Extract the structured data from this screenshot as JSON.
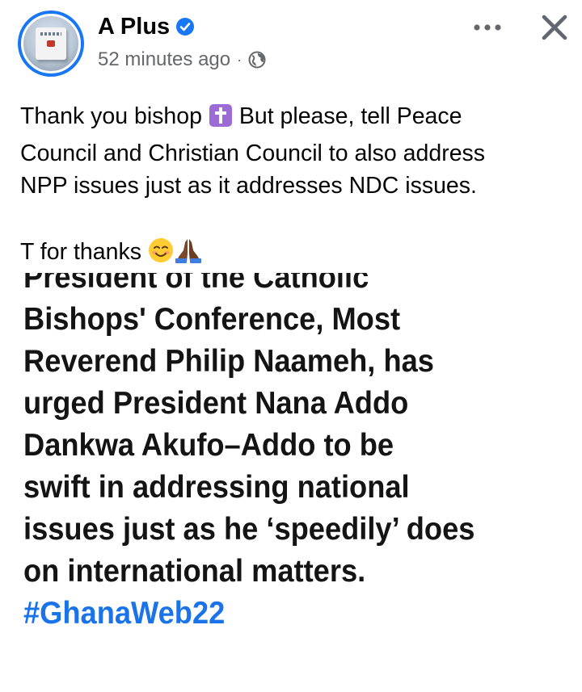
{
  "post": {
    "author": "A Plus",
    "time": "52 minutes ago",
    "separator": "·",
    "verified_icon": "verified-badge-icon",
    "privacy_icon": "globe-icon",
    "more_icon": "more-horizontal-icon",
    "close_icon": "close-icon",
    "caption": {
      "line1_before_emoji": "Thank you bishop",
      "line1_after_emoji": "But please, tell Peace",
      "line2": "Council and Christian Council to also address",
      "line3": "NPP issues just as it addresses NDC issues.",
      "line4_text": "T for thanks",
      "emoji_cross": "latin-cross-emoji",
      "emoji_smile": "smiling-face-emoji",
      "emoji_pray": "folded-hands-emoji"
    }
  },
  "image": {
    "lines": [
      "President of the Catholic",
      "Bishops' Conference, Most",
      "Reverend Philip Naameh, has",
      "urged President Nana Addo",
      "Dankwa Akufo–Addo to be",
      "swift in addressing national",
      "issues just as he ‘speedily’ does",
      "on international matters."
    ],
    "hashtag": "#GhanaWeb22"
  },
  "colors": {
    "verified": "#1877f2",
    "meta_text": "#65676b",
    "hashtag": "#1a73e8"
  }
}
